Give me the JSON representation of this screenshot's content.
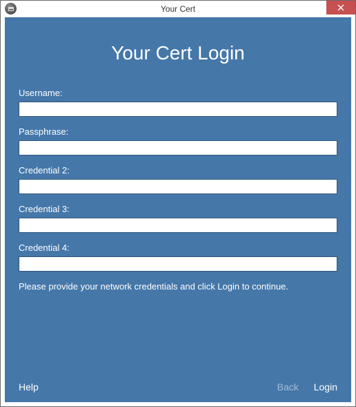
{
  "window": {
    "title": "Your Cert"
  },
  "page": {
    "heading": "Your Cert Login",
    "instruction": "Please provide your network credentials and click Login to continue."
  },
  "fields": {
    "username": {
      "label": "Username:",
      "value": ""
    },
    "passphrase": {
      "label": "Passphrase:",
      "value": ""
    },
    "cred2": {
      "label": "Credential 2:",
      "value": ""
    },
    "cred3": {
      "label": "Credential 3:",
      "value": ""
    },
    "cred4": {
      "label": "Credential 4:",
      "value": ""
    }
  },
  "footer": {
    "help": "Help",
    "back": "Back",
    "login": "Login"
  }
}
